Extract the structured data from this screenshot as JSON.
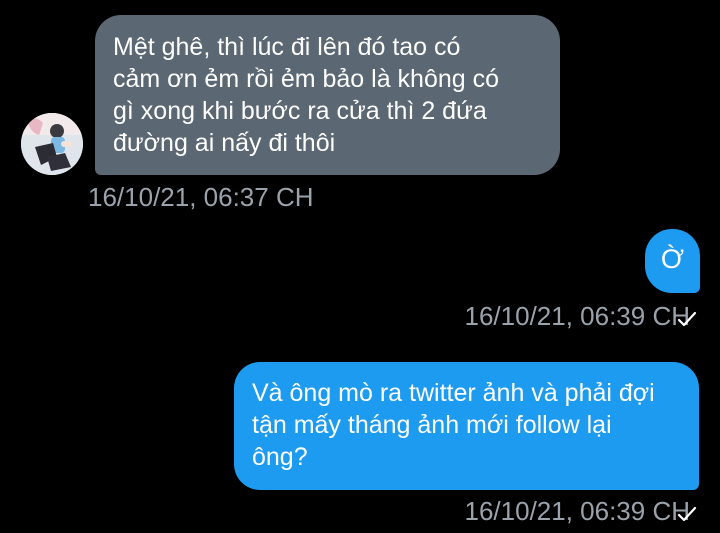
{
  "conversation": {
    "messages": [
      {
        "direction": "incoming",
        "text": "Mệt ghê, thì lúc đi lên đó tao có\ncảm ơn ẻm rồi ẻm bảo là không có\ngì xong khi bước ra cửa thì 2 đứa\nđường ai nấy đi thôi",
        "timestamp": "16/10/21, 06:37 CH"
      },
      {
        "direction": "outgoing",
        "text": "Ờ",
        "timestamp": "16/10/21, 06:39 CH",
        "status_icon": "checkmark-icon"
      },
      {
        "direction": "outgoing",
        "text": "Và ông mò ra twitter ảnh và phải đợi\ntận mấy tháng ảnh mới follow lại\nông?",
        "timestamp": "16/10/21, 06:39 CH",
        "status_icon": "checkmark-icon"
      }
    ],
    "avatar_icon": "avatar-photo"
  },
  "colors": {
    "background": "#000000",
    "incoming_bubble": "#5b6772",
    "outgoing_bubble": "#1d9bf0",
    "timestamp_text": "#9aa3ac",
    "message_text": "#ffffff"
  }
}
